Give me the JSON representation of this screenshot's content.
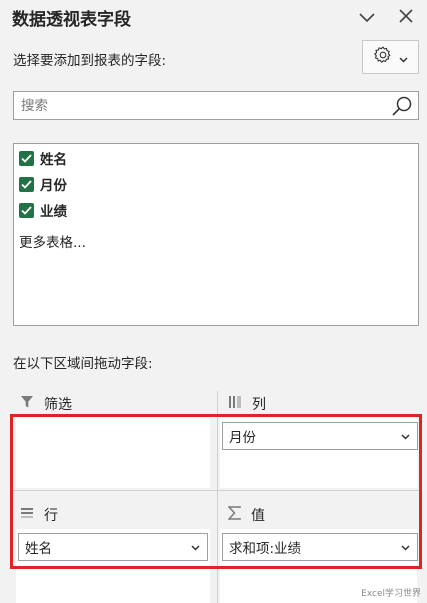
{
  "header": {
    "title": "数据透视表字段",
    "collapse_icon": "chevron-down-icon",
    "close_icon": "close-icon"
  },
  "subtitle": "选择要添加到报表的字段:",
  "settings": {
    "icon": "gear-icon",
    "dropdown_icon": "chevron-down-icon"
  },
  "search": {
    "placeholder": "搜索",
    "value": ""
  },
  "fields": [
    {
      "label": "姓名",
      "checked": true
    },
    {
      "label": "月份",
      "checked": true
    },
    {
      "label": "业绩",
      "checked": true
    }
  ],
  "more_tables": "更多表格...",
  "areas_hint": "在以下区域间拖动字段:",
  "areas": {
    "filter": {
      "label": "筛选",
      "icon": "filter-icon",
      "items": []
    },
    "columns": {
      "label": "列",
      "icon": "columns-icon",
      "items": [
        "月份"
      ]
    },
    "rows": {
      "label": "行",
      "icon": "rows-icon",
      "items": [
        "姓名"
      ]
    },
    "values": {
      "label": "值",
      "icon": "sigma-icon",
      "items": [
        "求和项:业绩"
      ]
    }
  },
  "watermark": "Excel学习世界",
  "colors": {
    "accent": "#217346",
    "highlight": "#e02424"
  }
}
